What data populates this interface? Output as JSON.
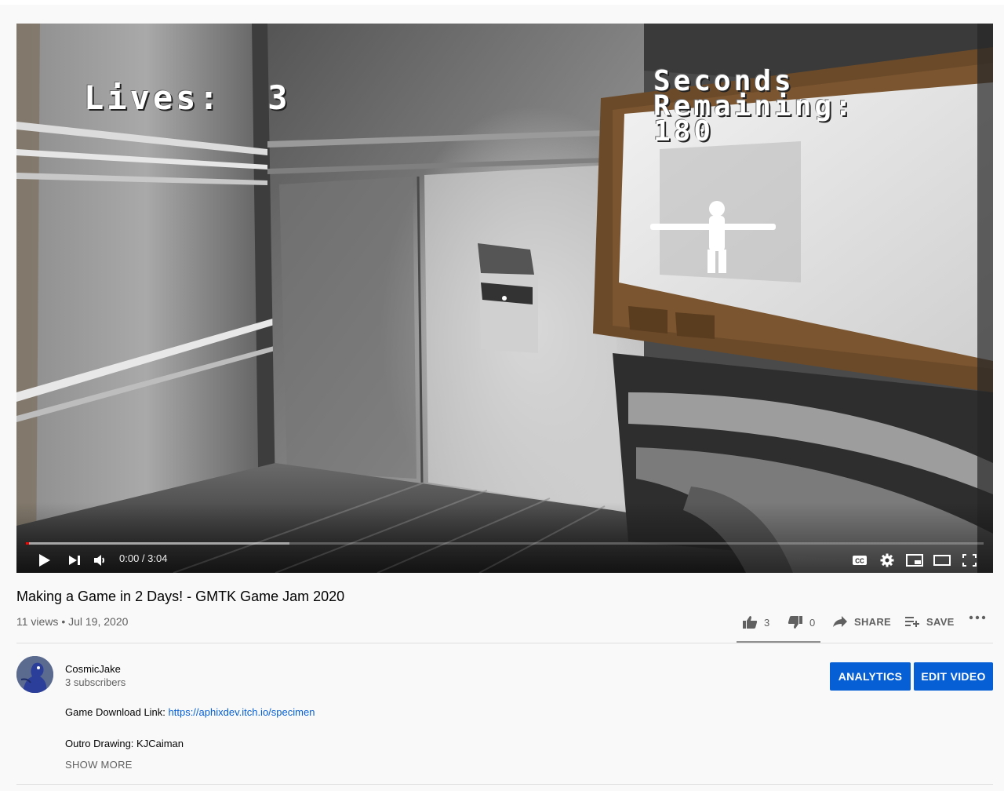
{
  "player": {
    "hud_lives": "Lives:  3",
    "hud_seconds_line1": "Seconds",
    "hud_seconds_line2": "Remaining:",
    "hud_seconds_line3": "180",
    "time": "0:00 / 3:04",
    "progress_played_fraction": 0.0,
    "progress_loaded_fraction": 0.275,
    "icons": [
      "play-icon",
      "next-icon",
      "volume-icon",
      "captions-icon",
      "settings-icon",
      "miniplayer-icon",
      "theater-icon",
      "fullscreen-icon"
    ]
  },
  "video": {
    "title": "Making a Game in 2 Days! - GMTK Game Jam 2020",
    "meta": "11 views • Jul 19, 2020"
  },
  "actions": {
    "likes": "3",
    "dislikes": "0",
    "share_label": "SHARE",
    "save_label": "SAVE"
  },
  "channel": {
    "name": "CosmicJake",
    "subscribers": "3 subscribers"
  },
  "buttons": {
    "analytics": "ANALYTICS",
    "edit_video": "EDIT VIDEO"
  },
  "description": {
    "line1_label": "Game Download Link: ",
    "line1_link": "https://aphixdev.itch.io/specimen",
    "line2": "Outro Drawing: KJCaiman",
    "show_more": "SHOW MORE"
  },
  "colors": {
    "accent_blue": "#065fd4",
    "progress_red": "#ff0000",
    "background": "#f9f9f9"
  }
}
